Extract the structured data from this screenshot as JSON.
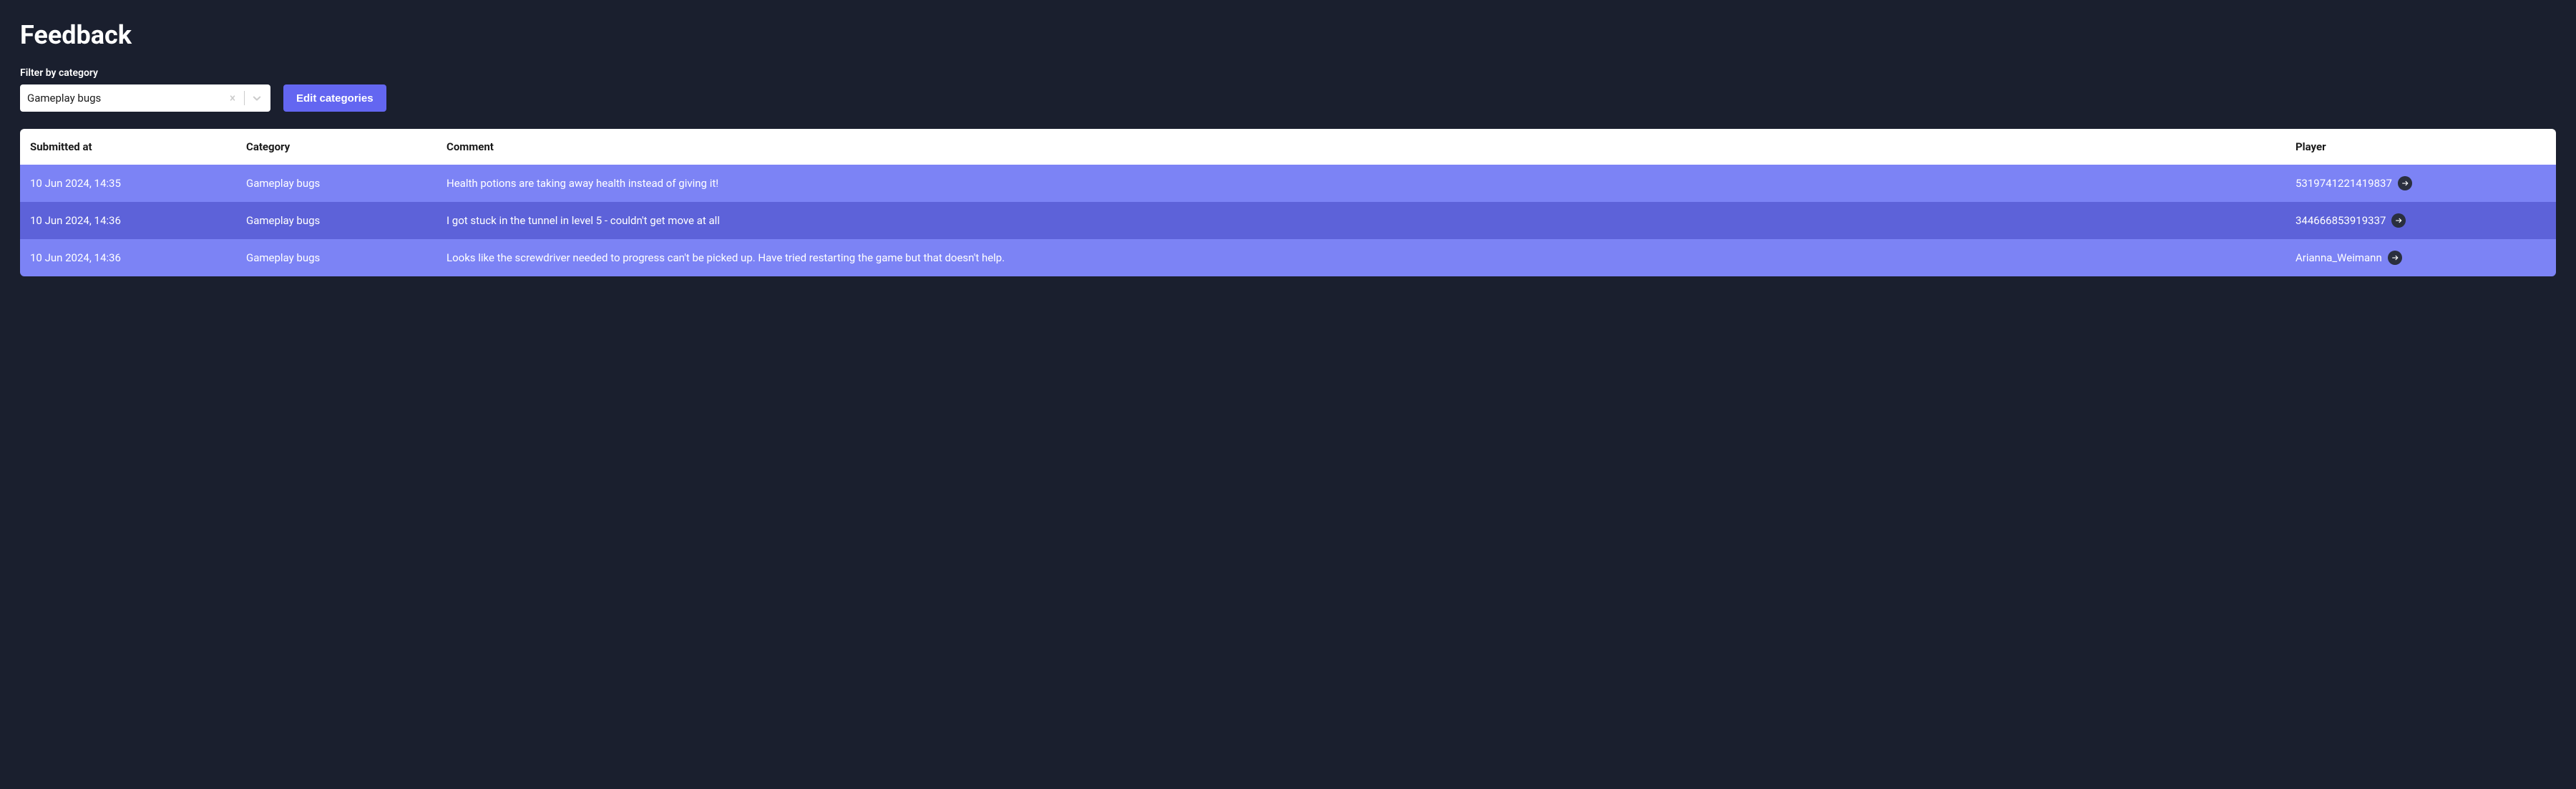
{
  "page": {
    "title": "Feedback"
  },
  "filter": {
    "label": "Filter by category",
    "selected": "Gameplay bugs"
  },
  "buttons": {
    "editCategories": "Edit categories"
  },
  "table": {
    "headers": {
      "submittedAt": "Submitted at",
      "category": "Category",
      "comment": "Comment",
      "player": "Player"
    },
    "rows": [
      {
        "submittedAt": "10 Jun 2024, 14:35",
        "category": "Gameplay bugs",
        "comment": "Health potions are taking away health instead of giving it!",
        "player": "5319741221419837"
      },
      {
        "submittedAt": "10 Jun 2024, 14:36",
        "category": "Gameplay bugs",
        "comment": "I got stuck in the tunnel in level 5 - couldn't get move at all",
        "player": "344666853919337"
      },
      {
        "submittedAt": "10 Jun 2024, 14:36",
        "category": "Gameplay bugs",
        "comment": "Looks like the screwdriver needed to progress can't be picked up. Have tried restarting the game but that doesn't help.",
        "player": "Arianna_Weimann"
      }
    ]
  }
}
